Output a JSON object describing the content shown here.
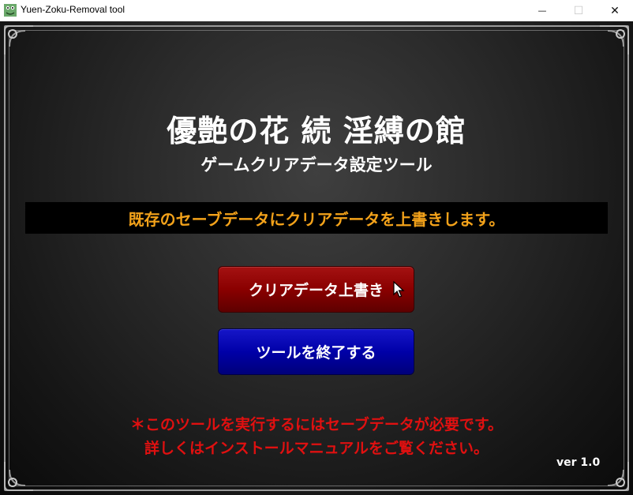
{
  "window": {
    "title": "Yuen-Zoku-Removal tool",
    "icon": "frog-app-icon",
    "minimize_glyph": "—",
    "maximize_glyph": "☐",
    "close_glyph": "✕"
  },
  "main": {
    "title": "優艶の花 続 淫縛の館",
    "subtitle": "ゲームクリアデータ設定ツール",
    "banner": "既存のセーブデータにクリアデータを上書きします。",
    "buttons": {
      "overwrite_label": "クリアデータ上書き",
      "quit_label": "ツールを終了する"
    },
    "notes": [
      "＊このツールを実行するにはセーブデータが必要です。",
      "詳しくはインストールマニュアルをご覧ください。"
    ],
    "version": "ver 1.0"
  },
  "colors": {
    "banner_text": "#f3a21a",
    "note_text": "#e01010",
    "button_red": "#8a0000",
    "button_blue": "#0000a8"
  }
}
